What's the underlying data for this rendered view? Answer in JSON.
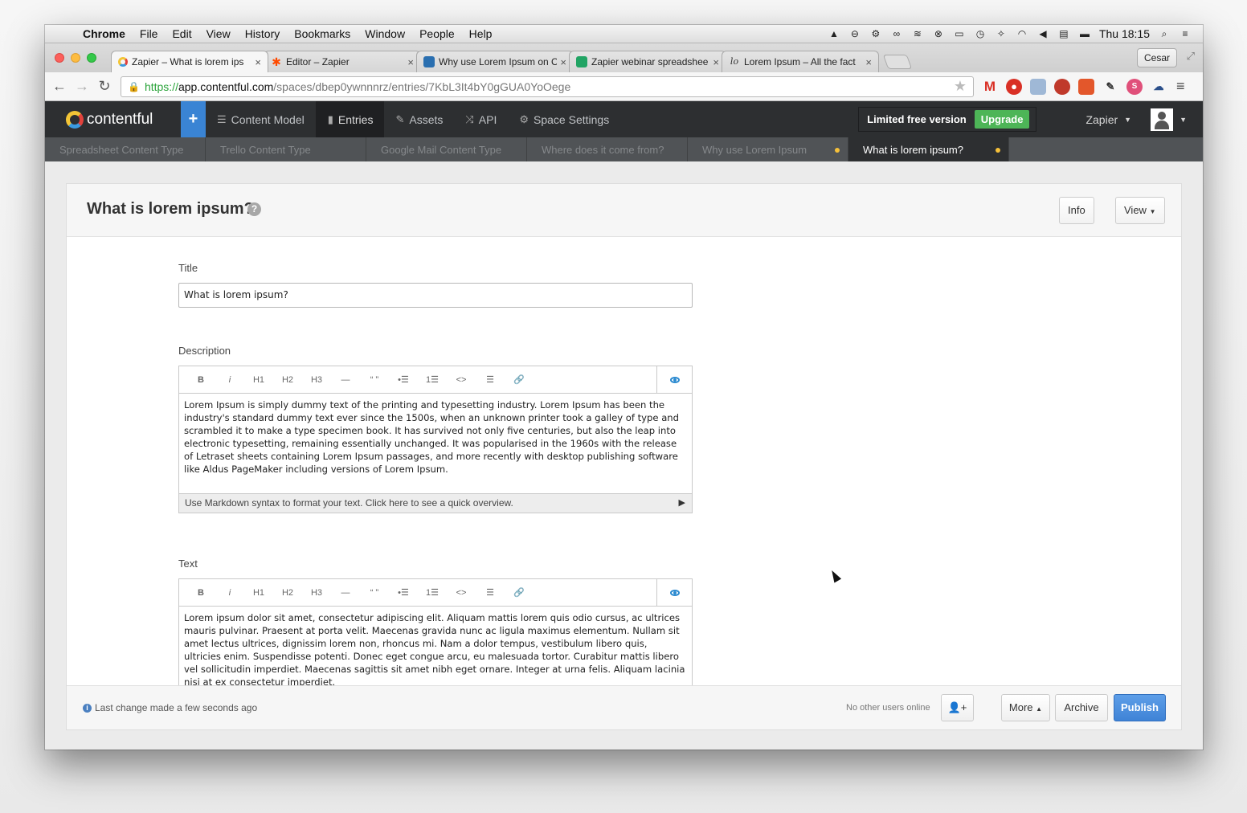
{
  "menubar": {
    "app": "Chrome",
    "items": [
      "File",
      "Edit",
      "View",
      "History",
      "Bookmarks",
      "Window",
      "People",
      "Help"
    ],
    "clock": "Thu 18:15"
  },
  "browser": {
    "tabs": [
      {
        "title": "Zapier – What is lorem ips",
        "icon": "contentful-icon",
        "active": true
      },
      {
        "title": "Editor – Zapier",
        "icon": "zapier-icon",
        "active": false
      },
      {
        "title": "Why use Lorem Ipsum on C",
        "icon": "trello-icon",
        "active": false
      },
      {
        "title": "Zapier webinar spreadshee",
        "icon": "sheets-icon",
        "active": false
      },
      {
        "title": "Lorem Ipsum – All the fact",
        "icon": "lorem-icon",
        "active": false
      }
    ],
    "profile": "Cesar",
    "url_scheme": "https://",
    "url_host": "app.contentful.com",
    "url_path": "/spaces/dbep0ywnnnrz/entries/7KbL3It4bY0gGUA0YoOege"
  },
  "topnav": {
    "brand": "contentful",
    "plus": "+",
    "items": [
      {
        "label": "Content Model",
        "icon": "database-icon"
      },
      {
        "label": "Entries",
        "icon": "document-icon"
      },
      {
        "label": "Assets",
        "icon": "paperclip-icon"
      },
      {
        "label": "API",
        "icon": "shuffle-icon"
      },
      {
        "label": "Space Settings",
        "icon": "gear-icon"
      }
    ],
    "limited": "Limited free version",
    "upgrade": "Upgrade",
    "user": "Zapier"
  },
  "entry_tabs": [
    {
      "label": "Spreadsheet Content Type",
      "dirty": false,
      "active": false
    },
    {
      "label": "Trello Content Type",
      "dirty": false,
      "active": false
    },
    {
      "label": "Google Mail Content Type",
      "dirty": false,
      "active": false
    },
    {
      "label": "Where does it come from?",
      "dirty": false,
      "active": false
    },
    {
      "label": "Why use Lorem Ipsum",
      "dirty": true,
      "active": false
    },
    {
      "label": "What is lorem ipsum?",
      "dirty": true,
      "active": true
    }
  ],
  "entry": {
    "title": "What is lorem ipsum?",
    "info_btn": "Info",
    "view_btn": "View",
    "fields": {
      "title_label": "Title",
      "title_value": "What is lorem ipsum?",
      "description_label": "Description",
      "description_value": "Lorem Ipsum is simply dummy text of the printing and typesetting industry. Lorem Ipsum has been the industry's standard dummy text ever since the 1500s, when an unknown printer took a galley of type and scrambled it to make a type specimen book. It has survived not only five centuries, but also the leap into electronic typesetting, remaining essentially unchanged. It was popularised in the 1960s with the release of Letraset sheets containing Lorem Ipsum passages, and more recently with desktop publishing software like Aldus PageMaker including versions of Lorem Ipsum.",
      "markdown_hint": "Use Markdown syntax to format your text. Click here to see a quick overview.",
      "text_label": "Text",
      "text_value": "Lorem ipsum dolor sit amet, consectetur adipiscing elit. Aliquam mattis lorem quis odio cursus, ac ultrices mauris pulvinar. Praesent at porta velit. Maecenas gravida nunc ac ligula maximus elementum. Nullam sit amet lectus ultrices, dignissim lorem non, rhoncus mi. Nam a dolor tempus, vestibulum libero quis, ultricies enim. Suspendisse potenti. Donec eget congue arcu, eu malesuada tortor. Curabitur mattis libero vel sollicitudin imperdiet. Maecenas sagittis sit amet nibh eget ornare. Integer at urna felis. Aliquam lacinia nisi at ex consectetur imperdiet."
    },
    "toolbar": [
      "B",
      "i",
      "H1",
      "H2",
      "H3",
      "—",
      "“ ”",
      "•☰",
      "1☰",
      "<>",
      "☰",
      "🔗"
    ]
  },
  "footer": {
    "last_change": "Last change made a few seconds ago",
    "online": "No other users online",
    "more": "More",
    "archive": "Archive",
    "publish": "Publish"
  },
  "colors": {
    "nav_bg": "#2d2f31",
    "accent": "#3a84d4",
    "upgrade": "#4db557",
    "dirty_dot": "#f5c03a"
  }
}
